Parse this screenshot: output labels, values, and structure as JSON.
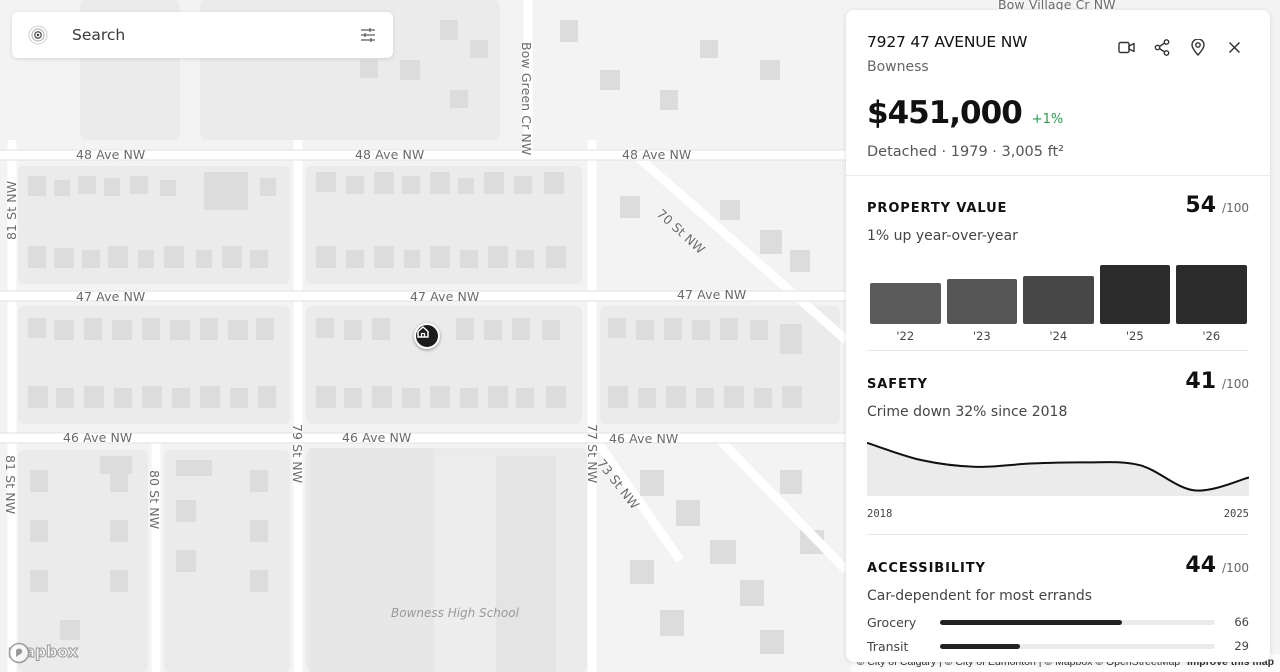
{
  "search": {
    "placeholder": "Search"
  },
  "map": {
    "streets": {
      "ave48_a": "48 Ave NW",
      "ave48_b": "48 Ave NW",
      "ave48_c": "48 Ave NW",
      "ave47_a": "47 Ave NW",
      "ave47_b": "47 Ave NW",
      "ave47_c": "47 Ave NW",
      "ave46_a": "46 Ave NW",
      "ave46_b": "46 Ave NW",
      "ave46_c": "46 Ave NW",
      "st81_a": "81 St NW",
      "st81_b": "81 St NW",
      "st80": "80 St NW",
      "st79": "79 St NW",
      "st77": "77 St NW",
      "st73": "73 St NW",
      "st70": "70 St NW",
      "bow_green": "Bow Green Cr NW",
      "bow_village": "Bow Village Cr NW"
    },
    "poi": "Bowness High School",
    "brand": "mapbox",
    "attribution": "© City of Calgary | © City of Edmonton | © Mapbox © OpenStreetMap",
    "improve": "Improve this map"
  },
  "panel": {
    "address": "7927 47 AVENUE NW",
    "neighborhood": "Bowness",
    "price": "$451,000",
    "price_change": "+1%",
    "facts": "Detached · 1979 · 3,005 ft²",
    "actions": [
      "video-icon",
      "share-icon",
      "pin-icon",
      "close-icon"
    ],
    "property_value": {
      "title": "PROPERTY VALUE",
      "score": "54",
      "max": "/100",
      "subtitle": "1% up year-over-year"
    },
    "safety": {
      "title": "SAFETY",
      "score": "41",
      "max": "/100",
      "subtitle": "Crime down 32% since 2018",
      "start_label": "2018",
      "end_label": "2025"
    },
    "accessibility": {
      "title": "ACCESSIBILITY",
      "score": "44",
      "max": "/100",
      "subtitle": "Car-dependent for most errands",
      "metrics": [
        {
          "label": "Grocery",
          "value": 66
        },
        {
          "label": "Transit",
          "value": 29
        }
      ]
    }
  },
  "chart_data": [
    {
      "type": "bar",
      "title": "",
      "categories": [
        "'22",
        "'23",
        "'24",
        "'25",
        "'26"
      ],
      "values": [
        0.7,
        0.76,
        0.82,
        1.0,
        1.0
      ],
      "colors": [
        "#5a5a5a",
        "#555555",
        "#474747",
        "#2b2b2b",
        "#2b2b2b"
      ]
    },
    {
      "type": "area",
      "title": "",
      "x": [
        2018,
        2019,
        2020,
        2021,
        2022,
        2023,
        2024,
        2025
      ],
      "y_relative": [
        0.95,
        0.64,
        0.52,
        0.58,
        0.6,
        0.55,
        0.1,
        0.33
      ],
      "xlabels": [
        "2018",
        "2025"
      ]
    }
  ]
}
